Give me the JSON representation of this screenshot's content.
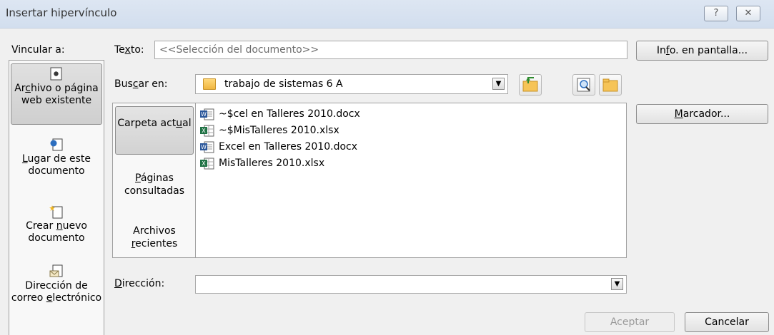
{
  "window": {
    "title": "Insertar hipervínculo",
    "help_glyph": "?",
    "close_glyph": "✕"
  },
  "link_to": {
    "label": "Vincular a:",
    "items": [
      {
        "pre": "Ar",
        "ul": "c",
        "post": "hivo o página web existente",
        "icon": "file-open-icon",
        "selected": true
      },
      {
        "pre": "",
        "ul": "L",
        "post": "ugar de este documento",
        "icon": "document-place-icon",
        "selected": false
      },
      {
        "pre": "Crear ",
        "ul": "n",
        "post": "uevo documento",
        "icon": "new-document-icon",
        "selected": false
      },
      {
        "pre": "Dirección de correo ",
        "ul": "e",
        "post": "lectrónico",
        "icon": "email-icon",
        "selected": false
      }
    ]
  },
  "text_field": {
    "label_pre": "Te",
    "label_ul": "x",
    "label_post": "to:",
    "value": "<<Selección del documento>>"
  },
  "screen_tip_button": {
    "pre": "In",
    "ul": "f",
    "post": "o. en pantalla..."
  },
  "look_in": {
    "label_pre": "Bus",
    "label_ul": "c",
    "label_post": "ar en:",
    "value": "trabajo de sistemas 6 A",
    "icons": [
      "up-folder-icon",
      "browse-web-icon",
      "browse-file-icon"
    ]
  },
  "bookmark_button": {
    "pre": "",
    "ul": "M",
    "post": "arcador..."
  },
  "scope_tabs": [
    {
      "pre": "Carpeta act",
      "ul": "u",
      "post": "al",
      "selected": true
    },
    {
      "pre": "",
      "ul": "P",
      "post": "áginas consultadas",
      "selected": false
    },
    {
      "pre": "Archivos ",
      "ul": "r",
      "post": "ecientes",
      "selected": false
    }
  ],
  "files": [
    {
      "name": "~$cel en Talleres 2010.docx",
      "icon": "word-doc-icon"
    },
    {
      "name": "~$MisTalleres 2010.xlsx",
      "icon": "excel-doc-icon"
    },
    {
      "name": "Excel en Talleres 2010.docx",
      "icon": "word-doc-icon"
    },
    {
      "name": "MisTalleres 2010.xlsx",
      "icon": "excel-doc-icon"
    }
  ],
  "address": {
    "label_pre": "",
    "label_ul": "D",
    "label_post": "irección:",
    "value": ""
  },
  "ok_button": {
    "label": "Aceptar",
    "enabled": false
  },
  "cancel_button": {
    "label": "Cancelar"
  },
  "colors": {
    "word": "#2b579a",
    "excel": "#217346",
    "folder": "#f0b640"
  }
}
